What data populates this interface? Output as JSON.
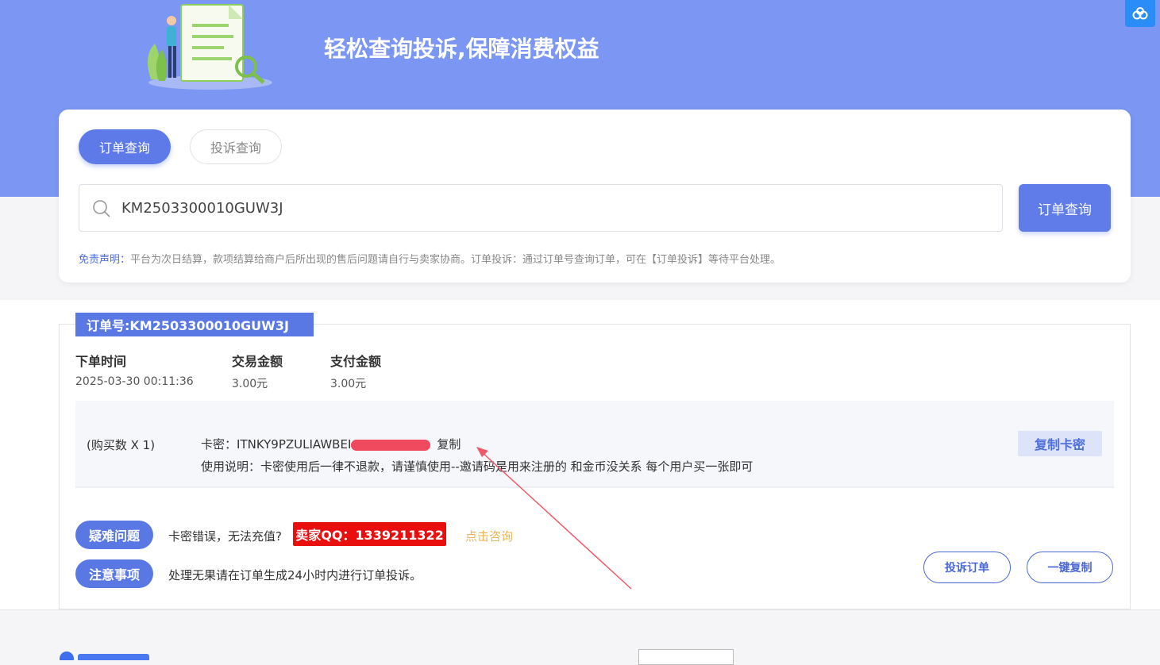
{
  "hero": {
    "title": "轻松查询投诉,保障消费权益"
  },
  "search": {
    "tabs": [
      {
        "label": "订单查询",
        "active": true
      },
      {
        "label": "投诉查询",
        "active": false
      }
    ],
    "input_value": "KM2503300010GUW3J",
    "button_label": "订单查询",
    "disclaimer_label": "免责声明：",
    "disclaimer_text": "平台为次日结算，款项结算给商户后所出现的售后问题请自行与卖家协商。订单投诉：通过订单号查询订单，可在【订单投诉】等待平台处理。"
  },
  "order": {
    "tag": "订单号:KM2503300010GUW3J",
    "fields": [
      {
        "label": "下单时间",
        "value": "2025-03-30 00:11:36"
      },
      {
        "label": "交易金额",
        "value": "3.00元"
      },
      {
        "label": "支付金额",
        "value": "3.00元"
      }
    ],
    "quantity": "(购买数 X 1)",
    "card_key_label": "卡密：",
    "card_key_value": "ITNKY9PZULIAWBEI",
    "copy_link": "复制",
    "usage": "使用说明：卡密使用后一律不退款，请谨慎使用--邀请码是用来注册的 和金币没关系 每个用户买一张即可",
    "copy_card_button": "复制卡密"
  },
  "issues": {
    "difficult_label": "疑难问题",
    "difficult_text": "卡密错误，无法充值?",
    "seller_qq": "卖家QQ：1339211322",
    "consult_link": "点击咨询",
    "notice_label": "注意事项",
    "notice_text": "处理无果请在订单生成24小时内进行订单投诉。",
    "complain_button": "投诉订单",
    "copy_all_button": "一键复制"
  },
  "colors": {
    "hero_bg": "#7b96f3",
    "accent": "#5a78e4",
    "qq_red": "#ea0f0f",
    "consult": "#f0b457"
  },
  "icons": [
    "search-icon",
    "cloud-icon",
    "hero-illustration"
  ]
}
